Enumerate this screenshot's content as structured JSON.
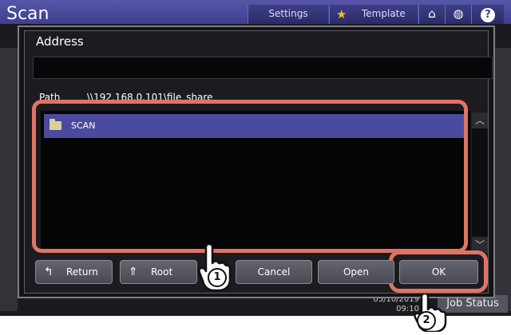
{
  "app": {
    "title": "Scan"
  },
  "topbar": {
    "settings_label": "Settings",
    "template_label": "Template",
    "help_label": "?",
    "icons": [
      "star-icon",
      "home-icon",
      "globe-icon",
      "help-icon"
    ]
  },
  "dialog": {
    "title": "Address",
    "path_label": "Path",
    "path_value": "\\\\192.168.0.101\\file_share",
    "items": [
      {
        "label": "SCAN",
        "icon": "folder-icon",
        "selected": true
      }
    ]
  },
  "buttons": {
    "return_label": "Return",
    "root_label": "Root",
    "cancel_label": "Cancel",
    "open_label": "Open",
    "ok_label": "OK"
  },
  "status": {
    "date": "05/10/2019",
    "time": "09:10",
    "job_status_label": "Job Status"
  },
  "callouts": [
    "1",
    "2"
  ],
  "colors": {
    "topbar": "#3f3f8e",
    "selection": "#4a4a9e",
    "highlight": "#e07462"
  }
}
